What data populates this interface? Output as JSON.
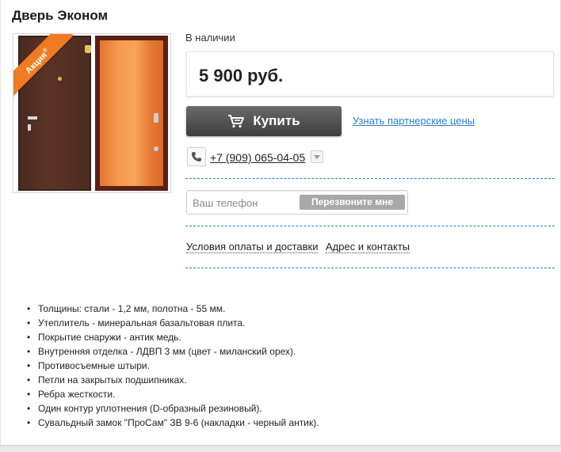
{
  "product": {
    "title": "Дверь Эконом",
    "badge": "Акция",
    "badge_mark": "®"
  },
  "availability": "В наличии",
  "price": "5 900 руб.",
  "buy_button": {
    "label": "Купить",
    "icon": "cart-icon"
  },
  "partner_link": "Узнать партнерские цены",
  "phone": {
    "icon": "phone-icon",
    "number": "+7 (909) 065-04-05",
    "dropdown_icon": "chevron-down-icon"
  },
  "callback": {
    "placeholder": "Ваш телефон",
    "button": "Перезвоните мне"
  },
  "links": {
    "delivery": "Условия оплаты и доставки",
    "contacts": "Адрес и контакты"
  },
  "features": [
    "Толщины: стали - 1,2 мм, полотна - 55 мм.",
    "Утеплитель - минеральная базальтовая плита.",
    "Покрытие снаружи - антик медь.",
    "Внутренняя отделка - ЛДВП 3 мм (цвет - миланский орех).",
    "Противосъемные штыри.",
    "Петли на закрытых подшипниках.",
    "Ребра жесткости.",
    "Один контур уплотнения (D-образный резиновый).",
    "Сувальдный замок \"ПроСам\" ЗВ 9-6 (накладки - черный антик)."
  ],
  "colors": {
    "accent_link": "#2a7fd0",
    "badge": "#ef7b23",
    "buy_button": "#4a4a4a"
  }
}
